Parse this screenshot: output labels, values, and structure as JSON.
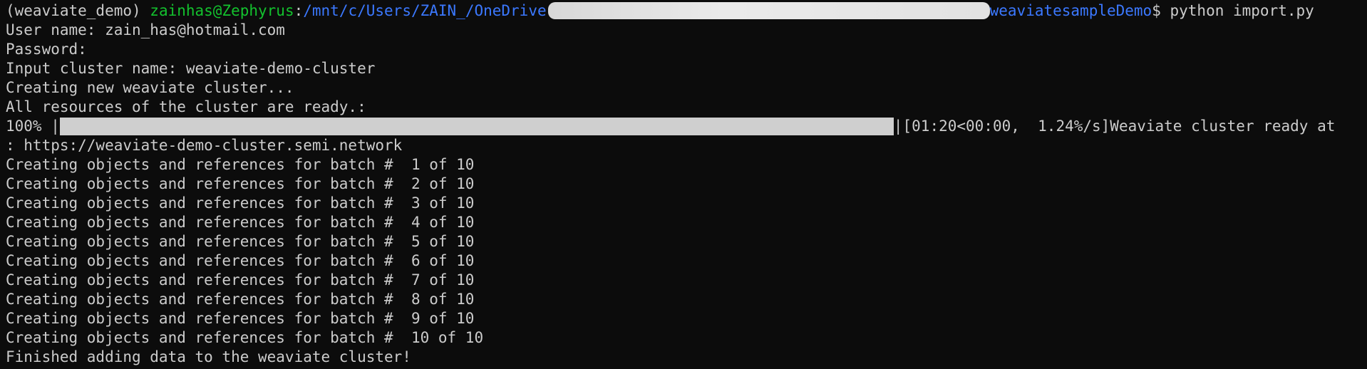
{
  "prompt": {
    "env": "(weaviate_demo) ",
    "user_host": "zainhas@Zephyrus",
    "colon": ":",
    "path_start": "/mnt/c/Users/ZAIN_/OneDrive",
    "path_end": "weaviatesampleDemo",
    "dollar": "$ ",
    "command": "python import.py"
  },
  "lines": {
    "username": "User name: zain_has@hotmail.com",
    "password": "Password:",
    "cluster_name": "Input cluster name: weaviate-demo-cluster",
    "creating": "Creating new weaviate cluster...",
    "resources_ready": "All resources of the cluster are ready.:"
  },
  "progress": {
    "percent_label": "100% |",
    "fraction": 1.0,
    "end_pipe": "|",
    "timing": "[01:20<00:00,  1.24%/s]Weaviate cluster ready at",
    "url_line": ": https://weaviate-demo-cluster.semi.network"
  },
  "batches": [
    "Creating objects and references for batch #  1 of 10",
    "Creating objects and references for batch #  2 of 10",
    "Creating objects and references for batch #  3 of 10",
    "Creating objects and references for batch #  4 of 10",
    "Creating objects and references for batch #  5 of 10",
    "Creating objects and references for batch #  6 of 10",
    "Creating objects and references for batch #  7 of 10",
    "Creating objects and references for batch #  8 of 10",
    "Creating objects and references for batch #  9 of 10",
    "Creating objects and references for batch #  10 of 10"
  ],
  "finished": "Finished adding data to the weaviate cluster!",
  "colors": {
    "background": "#0c0c0c",
    "text": "#cccccc",
    "user_host": "#13c22e",
    "path": "#3b78ff"
  }
}
